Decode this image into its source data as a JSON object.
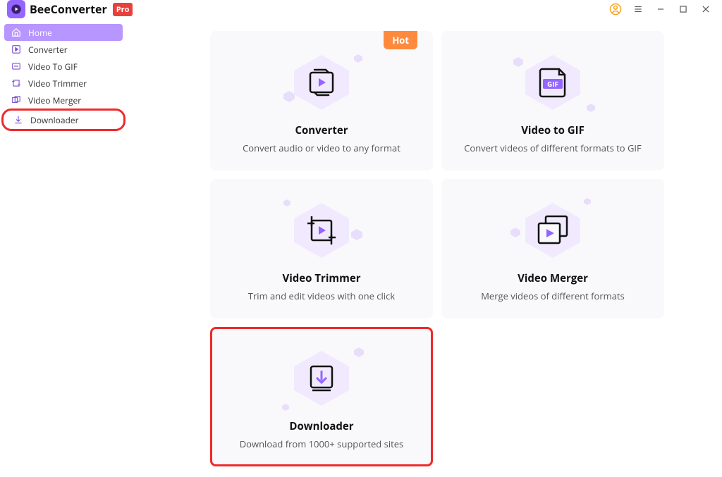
{
  "brand": {
    "name": "BeeConverter",
    "badge": "Pro"
  },
  "sidebar": {
    "items": [
      {
        "label": "Home",
        "icon": "home"
      },
      {
        "label": "Converter",
        "icon": "play"
      },
      {
        "label": "Video To GIF",
        "icon": "gif"
      },
      {
        "label": "Video Trimmer",
        "icon": "trim"
      },
      {
        "label": "Video Merger",
        "icon": "merge"
      },
      {
        "label": "Downloader",
        "icon": "download"
      }
    ]
  },
  "cards": {
    "converter": {
      "title": "Converter",
      "desc": "Convert audio or video to any format",
      "hot": "Hot"
    },
    "gif": {
      "title": "Video to GIF",
      "desc": "Convert videos of different formats to GIF"
    },
    "trimmer": {
      "title": "Video Trimmer",
      "desc": "Trim and edit videos with one click"
    },
    "merger": {
      "title": "Video Merger",
      "desc": "Merge videos of different formats"
    },
    "downloader": {
      "title": "Downloader",
      "desc": "Download from 1000+ supported sites"
    }
  }
}
